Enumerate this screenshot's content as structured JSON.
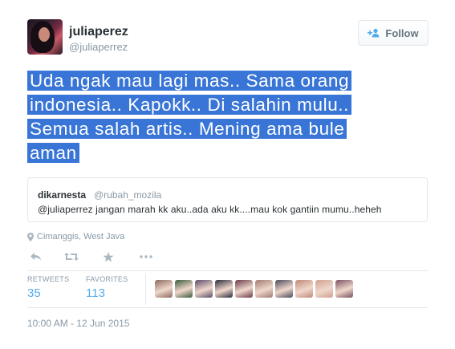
{
  "user": {
    "fullname": "juliaperez",
    "screen_name": "@juliaperrez"
  },
  "follow_button": {
    "label": "Follow"
  },
  "tweet": {
    "lines": [
      "Uda ngak mau lagi mas.. Sama orang",
      "indonesia.. Kapokk.. Di salahin mulu..",
      "Semua salah artis.. Mening ama bule",
      "aman"
    ]
  },
  "quoted": {
    "name": "dikarnesta",
    "handle": "@rubah_mozila",
    "text": "@juliaperrez jangan marah kk aku..ada aku kk....mau kok gantiin mumu..heheh"
  },
  "location": "Cimanggis, West Java",
  "stats": {
    "retweets_label": "RETWEETS",
    "retweets_count": "35",
    "favorites_label": "FAVORITES",
    "favorites_count": "113"
  },
  "favoriter_avatars": [
    {
      "color": "#8a6a5a"
    },
    {
      "color": "#3a5a3a"
    },
    {
      "color": "#5a4a6a"
    },
    {
      "color": "#2a2a3a"
    },
    {
      "color": "#6a3a4a"
    },
    {
      "color": "#a07a70"
    },
    {
      "color": "#4a4a5a"
    },
    {
      "color": "#c08878"
    },
    {
      "color": "#d0a090"
    },
    {
      "color": "#7a5060"
    }
  ],
  "timestamp": "10:00 AM - 12 Jun 2015",
  "colors": {
    "highlight": "#3875d7",
    "link": "#55acee",
    "muted": "#8899a6"
  }
}
